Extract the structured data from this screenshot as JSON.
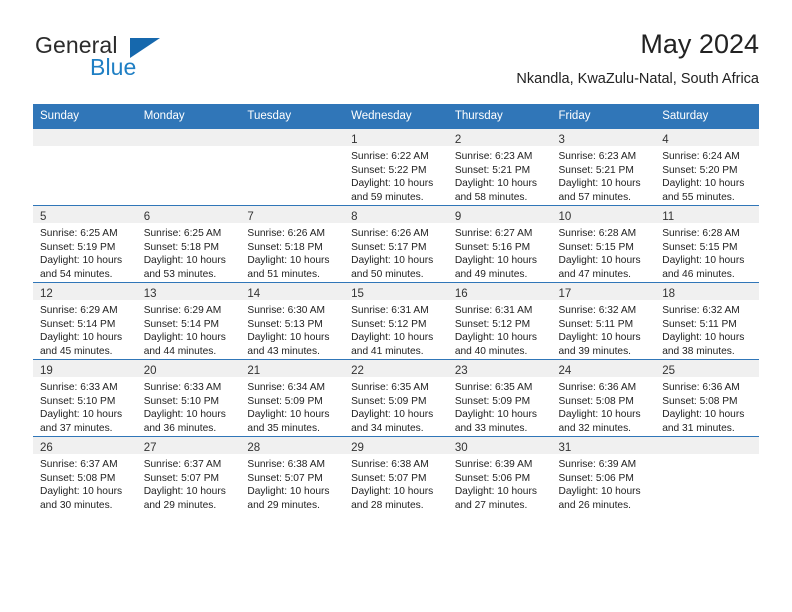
{
  "logo": {
    "word1": "General",
    "word2": "Blue",
    "triangle_color": "#1668ad",
    "blue_text_color": "#1f7fc4"
  },
  "header": {
    "title": "May 2024",
    "subtitle": "Nkandla, KwaZulu-Natal, South Africa",
    "header_bg_color": "#3076b8",
    "header_text_color": "#ffffff"
  },
  "calendar": {
    "weekday_headers": [
      "Sunday",
      "Monday",
      "Tuesday",
      "Wednesday",
      "Thursday",
      "Friday",
      "Saturday"
    ],
    "weeks": [
      [
        {
          "day": "",
          "lines": []
        },
        {
          "day": "",
          "lines": []
        },
        {
          "day": "",
          "lines": []
        },
        {
          "day": "1",
          "lines": [
            "Sunrise: 6:22 AM",
            "Sunset: 5:22 PM",
            "Daylight: 10 hours",
            "and 59 minutes."
          ]
        },
        {
          "day": "2",
          "lines": [
            "Sunrise: 6:23 AM",
            "Sunset: 5:21 PM",
            "Daylight: 10 hours",
            "and 58 minutes."
          ]
        },
        {
          "day": "3",
          "lines": [
            "Sunrise: 6:23 AM",
            "Sunset: 5:21 PM",
            "Daylight: 10 hours",
            "and 57 minutes."
          ]
        },
        {
          "day": "4",
          "lines": [
            "Sunrise: 6:24 AM",
            "Sunset: 5:20 PM",
            "Daylight: 10 hours",
            "and 55 minutes."
          ]
        }
      ],
      [
        {
          "day": "5",
          "lines": [
            "Sunrise: 6:25 AM",
            "Sunset: 5:19 PM",
            "Daylight: 10 hours",
            "and 54 minutes."
          ]
        },
        {
          "day": "6",
          "lines": [
            "Sunrise: 6:25 AM",
            "Sunset: 5:18 PM",
            "Daylight: 10 hours",
            "and 53 minutes."
          ]
        },
        {
          "day": "7",
          "lines": [
            "Sunrise: 6:26 AM",
            "Sunset: 5:18 PM",
            "Daylight: 10 hours",
            "and 51 minutes."
          ]
        },
        {
          "day": "8",
          "lines": [
            "Sunrise: 6:26 AM",
            "Sunset: 5:17 PM",
            "Daylight: 10 hours",
            "and 50 minutes."
          ]
        },
        {
          "day": "9",
          "lines": [
            "Sunrise: 6:27 AM",
            "Sunset: 5:16 PM",
            "Daylight: 10 hours",
            "and 49 minutes."
          ]
        },
        {
          "day": "10",
          "lines": [
            "Sunrise: 6:28 AM",
            "Sunset: 5:15 PM",
            "Daylight: 10 hours",
            "and 47 minutes."
          ]
        },
        {
          "day": "11",
          "lines": [
            "Sunrise: 6:28 AM",
            "Sunset: 5:15 PM",
            "Daylight: 10 hours",
            "and 46 minutes."
          ]
        }
      ],
      [
        {
          "day": "12",
          "lines": [
            "Sunrise: 6:29 AM",
            "Sunset: 5:14 PM",
            "Daylight: 10 hours",
            "and 45 minutes."
          ]
        },
        {
          "day": "13",
          "lines": [
            "Sunrise: 6:29 AM",
            "Sunset: 5:14 PM",
            "Daylight: 10 hours",
            "and 44 minutes."
          ]
        },
        {
          "day": "14",
          "lines": [
            "Sunrise: 6:30 AM",
            "Sunset: 5:13 PM",
            "Daylight: 10 hours",
            "and 43 minutes."
          ]
        },
        {
          "day": "15",
          "lines": [
            "Sunrise: 6:31 AM",
            "Sunset: 5:12 PM",
            "Daylight: 10 hours",
            "and 41 minutes."
          ]
        },
        {
          "day": "16",
          "lines": [
            "Sunrise: 6:31 AM",
            "Sunset: 5:12 PM",
            "Daylight: 10 hours",
            "and 40 minutes."
          ]
        },
        {
          "day": "17",
          "lines": [
            "Sunrise: 6:32 AM",
            "Sunset: 5:11 PM",
            "Daylight: 10 hours",
            "and 39 minutes."
          ]
        },
        {
          "day": "18",
          "lines": [
            "Sunrise: 6:32 AM",
            "Sunset: 5:11 PM",
            "Daylight: 10 hours",
            "and 38 minutes."
          ]
        }
      ],
      [
        {
          "day": "19",
          "lines": [
            "Sunrise: 6:33 AM",
            "Sunset: 5:10 PM",
            "Daylight: 10 hours",
            "and 37 minutes."
          ]
        },
        {
          "day": "20",
          "lines": [
            "Sunrise: 6:33 AM",
            "Sunset: 5:10 PM",
            "Daylight: 10 hours",
            "and 36 minutes."
          ]
        },
        {
          "day": "21",
          "lines": [
            "Sunrise: 6:34 AM",
            "Sunset: 5:09 PM",
            "Daylight: 10 hours",
            "and 35 minutes."
          ]
        },
        {
          "day": "22",
          "lines": [
            "Sunrise: 6:35 AM",
            "Sunset: 5:09 PM",
            "Daylight: 10 hours",
            "and 34 minutes."
          ]
        },
        {
          "day": "23",
          "lines": [
            "Sunrise: 6:35 AM",
            "Sunset: 5:09 PM",
            "Daylight: 10 hours",
            "and 33 minutes."
          ]
        },
        {
          "day": "24",
          "lines": [
            "Sunrise: 6:36 AM",
            "Sunset: 5:08 PM",
            "Daylight: 10 hours",
            "and 32 minutes."
          ]
        },
        {
          "day": "25",
          "lines": [
            "Sunrise: 6:36 AM",
            "Sunset: 5:08 PM",
            "Daylight: 10 hours",
            "and 31 minutes."
          ]
        }
      ],
      [
        {
          "day": "26",
          "lines": [
            "Sunrise: 6:37 AM",
            "Sunset: 5:08 PM",
            "Daylight: 10 hours",
            "and 30 minutes."
          ]
        },
        {
          "day": "27",
          "lines": [
            "Sunrise: 6:37 AM",
            "Sunset: 5:07 PM",
            "Daylight: 10 hours",
            "and 29 minutes."
          ]
        },
        {
          "day": "28",
          "lines": [
            "Sunrise: 6:38 AM",
            "Sunset: 5:07 PM",
            "Daylight: 10 hours",
            "and 29 minutes."
          ]
        },
        {
          "day": "29",
          "lines": [
            "Sunrise: 6:38 AM",
            "Sunset: 5:07 PM",
            "Daylight: 10 hours",
            "and 28 minutes."
          ]
        },
        {
          "day": "30",
          "lines": [
            "Sunrise: 6:39 AM",
            "Sunset: 5:06 PM",
            "Daylight: 10 hours",
            "and 27 minutes."
          ]
        },
        {
          "day": "31",
          "lines": [
            "Sunrise: 6:39 AM",
            "Sunset: 5:06 PM",
            "Daylight: 10 hours",
            "and 26 minutes."
          ]
        },
        {
          "day": "",
          "lines": []
        }
      ]
    ]
  }
}
